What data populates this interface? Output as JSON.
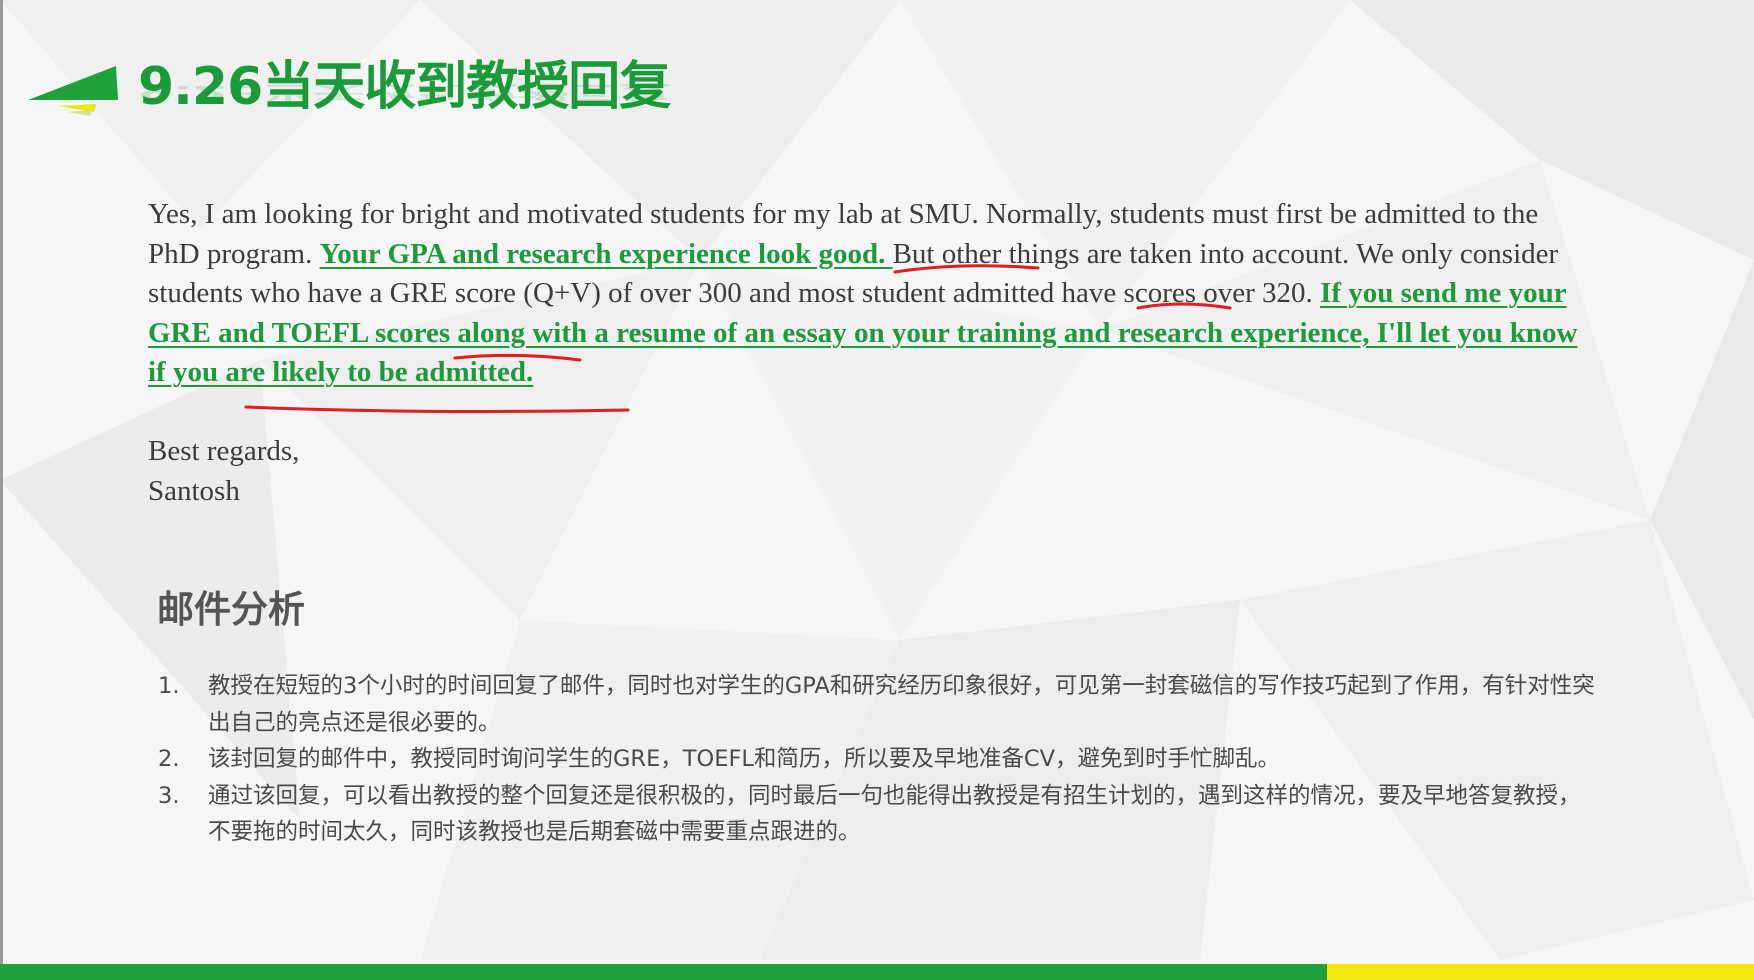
{
  "slide": {
    "title": "9.26当天收到教授回复",
    "colors": {
      "brand_green": "#1b9a3a",
      "highlight_green": "#1e9a3c",
      "accent_yellow": "#f2e60c",
      "annotation_red": "#e01e1e",
      "body_text": "#3c3c3c"
    },
    "icons": [
      "green-wedge-logo-icon"
    ]
  },
  "email": {
    "p1_a": "Yes, I am looking for bright and motivated students for my lab at SMU.  Normally, students must first be admitted to the PhD program.  ",
    "p1_highlight_1": "Your GPA and research experience look good. ",
    "p1_b": "But other things are taken into account. We only consider students who have a GRE score (Q+V) of over 300 and most student admitted have scores over 320.  ",
    "p1_highlight_2": "If you send me your GRE and TOEFL scores along with a resume of an essay on your training and research experience, I'll let you know if you are likely to be admitted.",
    "closing": "Best regards,",
    "signature": "Santosh"
  },
  "analysis": {
    "heading": "邮件分析",
    "items": [
      {
        "num": "1.",
        "text": "教授在短短的3个小时的时间回复了邮件，同时也对学生的GPA和研究经历印象很好，可见第一封套磁信的写作技巧起到了作用，有针对性突出自己的亮点还是很必要的。"
      },
      {
        "num": "2.",
        "text": " 该封回复的邮件中，教授同时询问学生的GRE，TOEFL和简历，所以要及早地准备CV，避免到时手忙脚乱。"
      },
      {
        "num": "3.",
        "text": " 通过该回复，可以看出教授的整个回复还是很积极的，同时最后一句也能得出教授是有招生计划的，遇到这样的情况，要及早地答复教授，不要拖的时间太久，同时该教授也是后期套磁中需要重点跟进的。"
      }
    ]
  }
}
